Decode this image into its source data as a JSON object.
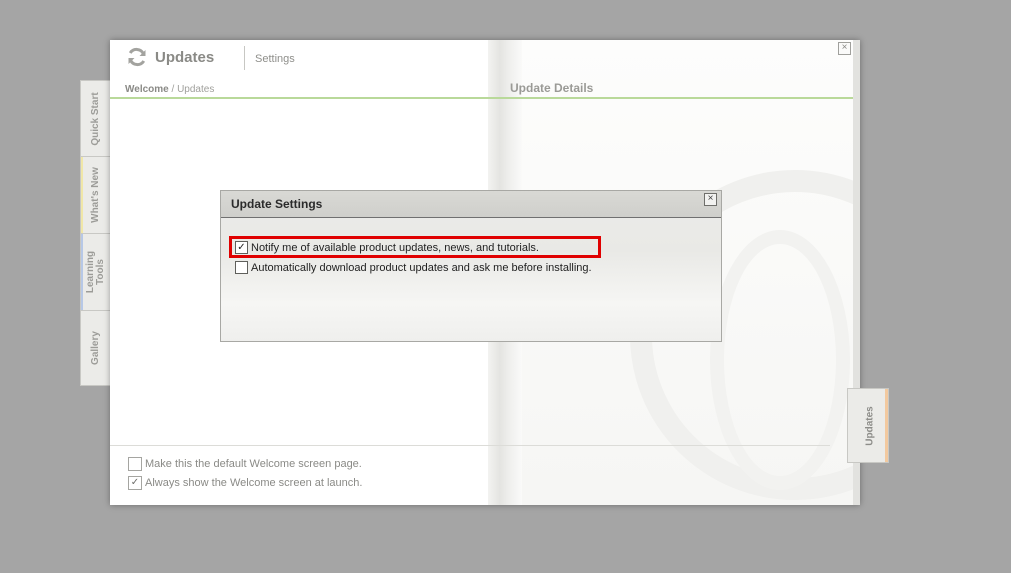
{
  "window": {
    "title": "Updates",
    "settings_link": "Settings",
    "breadcrumb_home": "Welcome",
    "breadcrumb_sep": " / ",
    "breadcrumb_current": "Updates",
    "details_title": "Update Details",
    "close_glyph": "×"
  },
  "left_tabs": [
    {
      "label": "Quick Start",
      "accent": ""
    },
    {
      "label": "What's New",
      "accent": "#f0e7a8"
    },
    {
      "label": "Learning Tools",
      "accent": "#b7c8e6"
    },
    {
      "label": "Gallery",
      "accent": ""
    }
  ],
  "right_tab": {
    "label": "Updates",
    "accent": "#f2c99f"
  },
  "footer": {
    "options": [
      {
        "label": "Make this the default Welcome screen page.",
        "checked": false,
        "mark": ""
      },
      {
        "label": "Always show the Welcome screen at launch.",
        "checked": true,
        "mark": "✓"
      }
    ]
  },
  "dialog": {
    "title": "Update Settings",
    "close_glyph": "×",
    "options": [
      {
        "label": "Notify me of available product updates, news, and tutorials.",
        "checked": true,
        "mark": "✓"
      },
      {
        "label": "Automatically download product updates and ask me before installing.",
        "checked": false,
        "mark": ""
      }
    ],
    "highlight_color": "#e00000"
  }
}
